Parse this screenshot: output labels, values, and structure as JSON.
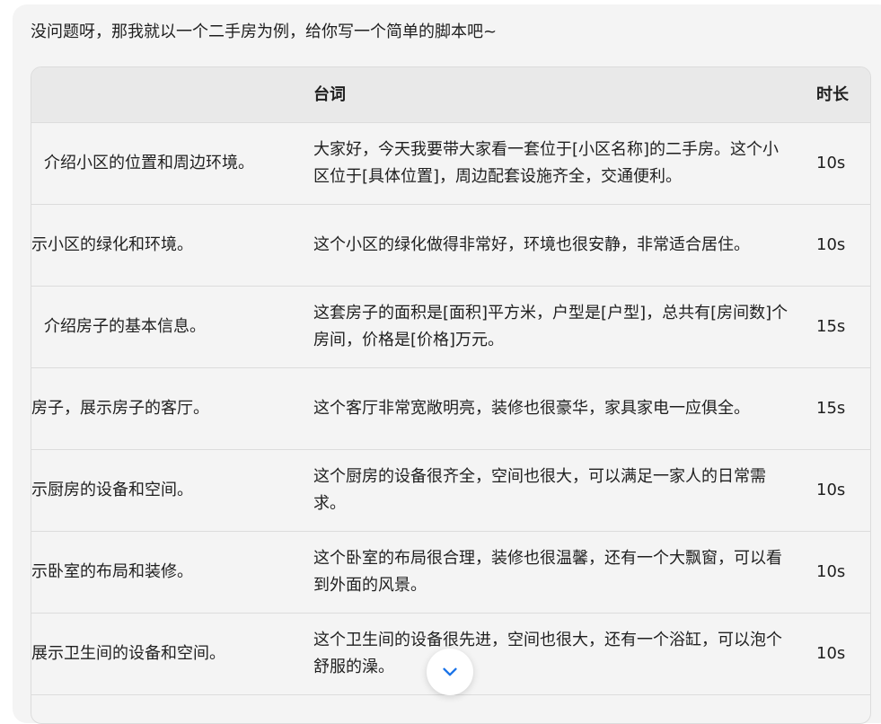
{
  "intro": "没问题呀，那我就以一个二手房为例，给你写一个简单的脚本吧~",
  "table": {
    "headers": {
      "line": "台词",
      "duration": "时长"
    },
    "rows": [
      {
        "scene": "介绍小区的位置和周边环境。",
        "line": "大家好，今天我要带大家看一套位于[小区名称]的二手房。这个小区位于[具体位置]，周边配套设施齐全，交通便利。",
        "duration": "10s"
      },
      {
        "scene": "示小区的绿化和环境。",
        "line": "这个小区的绿化做得非常好，环境也很安静，非常适合居住。",
        "duration": "10s"
      },
      {
        "scene": "介绍房子的基本信息。",
        "line": "这套房子的面积是[面积]平方米，户型是[户型]，总共有[房间数]个房间，价格是[价格]万元。",
        "duration": "15s"
      },
      {
        "scene": "房子，展示房子的客厅。",
        "line": "这个客厅非常宽敞明亮，装修也很豪华，家具家电一应俱全。",
        "duration": "15s"
      },
      {
        "scene": "示厨房的设备和空间。",
        "line": "这个厨房的设备很齐全，空间也很大，可以满足一家人的日常需求。",
        "duration": "10s"
      },
      {
        "scene": "示卧室的布局和装修。",
        "line": "这个卧室的布局很合理，装修也很温馨，还有一个大飘窗，可以看到外面的风景。",
        "duration": "10s"
      },
      {
        "scene": "展示卫生间的设备和空间。",
        "line": "这个卫生间的设备很先进，空间也很大，还有一个浴缸，可以泡个舒服的澡。",
        "duration": "10s"
      }
    ]
  },
  "scroll_button": {
    "icon": "chevron-down-icon",
    "color": "#1a73e8"
  }
}
